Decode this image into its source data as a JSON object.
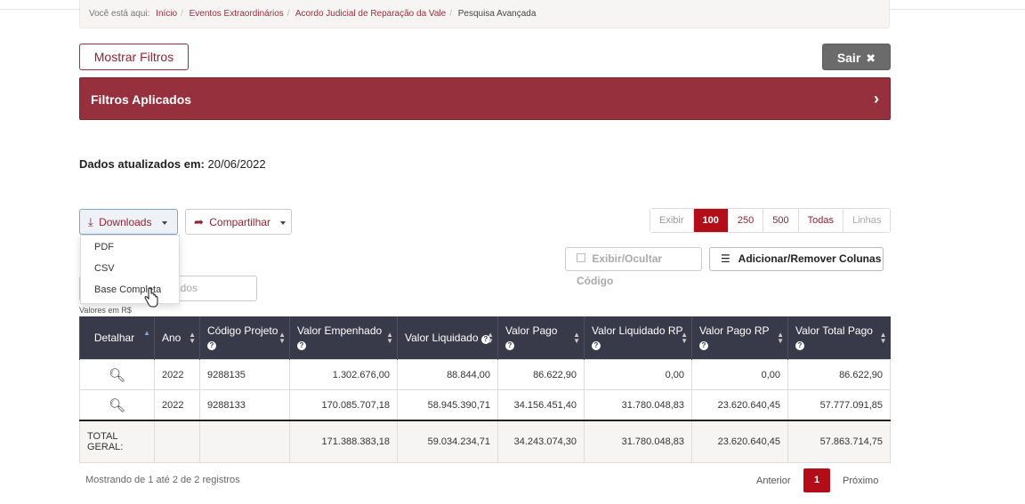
{
  "breadcrumb": {
    "prefix": "Você está aqui:",
    "items": [
      "Início",
      "Eventos Extraordinários",
      "Acordo Judicial de Reparação da Vale"
    ],
    "current": "Pesquisa Avançada"
  },
  "buttons": {
    "show_filters": "Mostrar Filtros",
    "exit": "Sair",
    "downloads": "Downloads",
    "share": "Compartilhar",
    "toggle_code": "Exibir/Ocultar Código",
    "columns": "Adicionar/Remover Colunas"
  },
  "filters_bar": {
    "title": "Filtros Aplicados"
  },
  "updated": {
    "label": "Dados atualizados em:",
    "date": "20/06/2022"
  },
  "rows_pager": {
    "label": "Exibir",
    "options": [
      "100",
      "250",
      "500",
      "Todas",
      "Linhas"
    ],
    "selected": "100"
  },
  "downloads_menu": {
    "items": [
      "PDF",
      "CSV",
      "Base Completa"
    ]
  },
  "search": {
    "placeholder_visible": "ados"
  },
  "units": "Valores em R$",
  "table": {
    "headers": [
      "Detalhar",
      "Ano",
      "Código Projeto",
      "Valor Empenhado",
      "Valor Liquidado",
      "Valor Pago",
      "Valor Liquidado RP",
      "Valor Pago RP",
      "Valor Total Pago"
    ],
    "rows": [
      [
        "2022",
        "9288135",
        "1.302.676,00",
        "88.844,00",
        "86.622,90",
        "0,00",
        "0,00",
        "86.622,90"
      ],
      [
        "2022",
        "9288133",
        "170.085.707,18",
        "58.945.390,71",
        "34.156.451,40",
        "31.780.048,83",
        "23.620.640,45",
        "57.777.091,85"
      ]
    ],
    "total": {
      "label": "TOTAL GERAL:",
      "values": [
        "171.388.383,18",
        "59.034.234,71",
        "34.243.074,30",
        "31.780.048,83",
        "23.620.640,45",
        "57.863.714,75"
      ]
    }
  },
  "footer": {
    "info": "Mostrando de 1 até 2 de 2 registros",
    "prev": "Anterior",
    "current_page": "1",
    "next": "Próximo"
  },
  "colors": {
    "brand": "#96303d",
    "active": "#b30d1a",
    "header_bg": "#383a4a"
  }
}
